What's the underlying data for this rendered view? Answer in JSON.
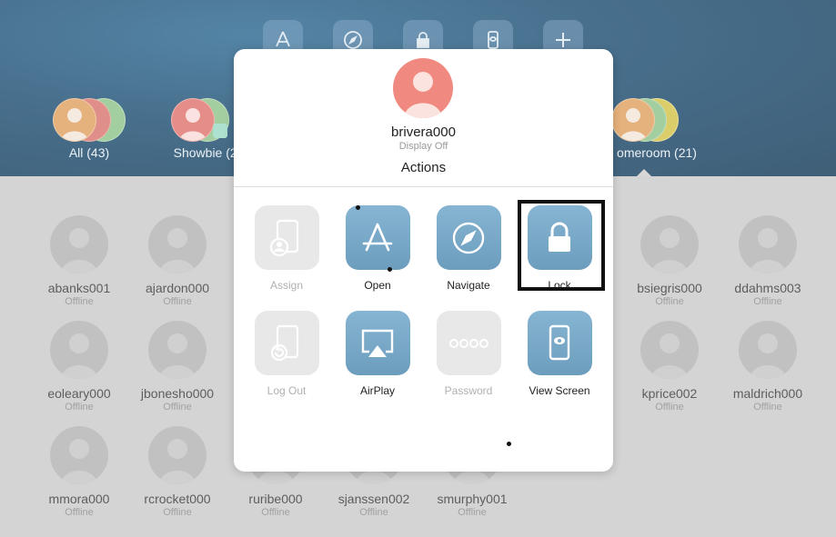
{
  "colors": {
    "accent": "#7aa9c9",
    "header": "#1f4f72",
    "avatar_pop": "#f08a80",
    "highlight": "#111111"
  },
  "toolbar": {
    "icons": [
      "app-store-icon",
      "compass-icon",
      "lock-icon",
      "view-screen-icon",
      "plus-icon"
    ]
  },
  "groups": [
    {
      "label": "All (43)"
    },
    {
      "label": "Showbie (2)"
    },
    {
      "label": "omeroom (21)"
    }
  ],
  "students": [
    {
      "name": "abanks001",
      "status": "Offline"
    },
    {
      "name": "ajardon000",
      "status": "Offline"
    },
    {
      "name": "bsiegris000",
      "status": "Offline"
    },
    {
      "name": "ddahms003",
      "status": "Offline"
    },
    {
      "name": "eoleary000",
      "status": "Offline"
    },
    {
      "name": "jbonesho000",
      "status": "Offline"
    },
    {
      "name": "kprice002",
      "status": "Offline"
    },
    {
      "name": "maldrich000",
      "status": "Offline"
    },
    {
      "name": "mmora000",
      "status": "Offline"
    },
    {
      "name": "rcrocket000",
      "status": "Offline"
    },
    {
      "name": "ruribe000",
      "status": "Offline"
    },
    {
      "name": "sjanssen002",
      "status": "Offline"
    },
    {
      "name": "smurphy001",
      "status": "Offline"
    }
  ],
  "popover": {
    "username": "brivera000",
    "status": "Display Off",
    "title": "Actions",
    "actions": [
      {
        "label": "Assign",
        "enabled": false
      },
      {
        "label": "Open",
        "enabled": true
      },
      {
        "label": "Navigate",
        "enabled": true
      },
      {
        "label": "Lock",
        "enabled": true
      },
      {
        "label": "Log Out",
        "enabled": false
      },
      {
        "label": "AirPlay",
        "enabled": true
      },
      {
        "label": "Password",
        "enabled": false
      },
      {
        "label": "View Screen",
        "enabled": true
      }
    ]
  }
}
